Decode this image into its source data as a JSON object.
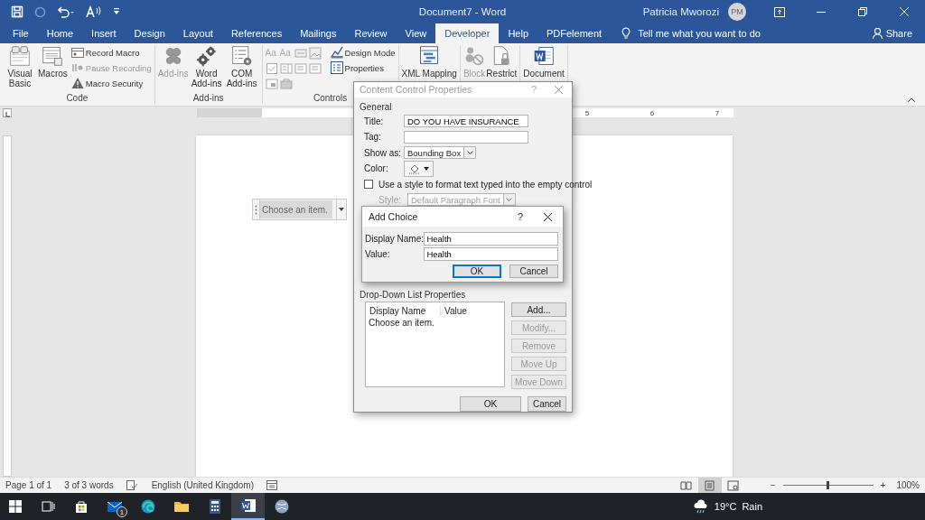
{
  "window": {
    "title": "Document7 - Word",
    "user": "Patricia Mworozi",
    "avatar": "PM"
  },
  "tabs": [
    {
      "label": "File",
      "selected": false
    },
    {
      "label": "Home",
      "selected": false
    },
    {
      "label": "Insert",
      "selected": false
    },
    {
      "label": "Design",
      "selected": false
    },
    {
      "label": "Layout",
      "selected": false
    },
    {
      "label": "References",
      "selected": false
    },
    {
      "label": "Mailings",
      "selected": false
    },
    {
      "label": "Review",
      "selected": false
    },
    {
      "label": "View",
      "selected": false
    },
    {
      "label": "Developer",
      "selected": true
    },
    {
      "label": "Help",
      "selected": false
    },
    {
      "label": "PDFelement",
      "selected": false
    }
  ],
  "tell_me": {
    "placeholder": "Tell me what you want to do"
  },
  "share": "Share",
  "ribbon": {
    "groups": [
      {
        "name": "Code",
        "items": [
          {
            "kind": "large",
            "label": "Visual Basic",
            "disabled": false
          },
          {
            "kind": "large",
            "label": "Macros",
            "disabled": false
          },
          {
            "kind": "stack",
            "buttons": [
              {
                "label": "Record Macro",
                "disabled": false
              },
              {
                "label": "Pause Recording",
                "disabled": true
              },
              {
                "label": "Macro Security",
                "disabled": false
              }
            ]
          }
        ]
      },
      {
        "name": "Add-ins",
        "items": [
          {
            "kind": "large",
            "label": "Add-ins",
            "disabled": true
          },
          {
            "kind": "large",
            "label": "Word Add-ins",
            "disabled": false
          },
          {
            "kind": "large",
            "label": "COM Add-ins",
            "disabled": false
          }
        ]
      },
      {
        "name": "Controls",
        "items": [
          {
            "kind": "grid",
            "glyphs": [
              "Aa",
              "Aa"
            ]
          },
          {
            "kind": "stack",
            "buttons": [
              {
                "label": "Design Mode",
                "disabled": false
              },
              {
                "label": "Properties",
                "disabled": false
              }
            ]
          }
        ]
      },
      {
        "items": [
          {
            "kind": "large",
            "label": "XML Mapping",
            "disabled": false
          }
        ]
      },
      {
        "items": [
          {
            "kind": "large",
            "label": "Block",
            "disabled": true
          },
          {
            "kind": "large",
            "label": "Restrict",
            "disabled": false
          }
        ]
      },
      {
        "items": [
          {
            "kind": "large",
            "label": "Document",
            "disabled": false
          }
        ]
      }
    ]
  },
  "ruler": {
    "labels": [
      "5",
      "6",
      "7"
    ]
  },
  "document": {
    "control": {
      "text": "Choose an item."
    }
  },
  "content_control_dialog": {
    "title": "Content Control Properties",
    "help": "?",
    "section_general": "General",
    "fields": [
      {
        "kind": "text",
        "label": "Title:",
        "value": "DO YOU HAVE INSURANCE"
      },
      {
        "kind": "text",
        "label": "Tag:"
      },
      {
        "kind": "dropdown",
        "label": "Show as:",
        "value": "Bounding Box"
      },
      {
        "kind": "color",
        "label": "Color:"
      }
    ],
    "use_style": {
      "label": "Use a style to format text typed into the empty control",
      "checked": false
    },
    "style": {
      "label": "Style:",
      "value": "Default Paragraph Font",
      "disabled": true
    },
    "list_section": "Drop-Down List Properties",
    "list": {
      "columns": [
        "Display Name",
        "Value"
      ],
      "rows": [
        {
          "display_name": "Choose an item."
        }
      ]
    },
    "list_buttons": [
      {
        "label": "Add...",
        "disabled": false
      },
      {
        "label": "Modify...",
        "disabled": true
      },
      {
        "label": "Remove",
        "disabled": true
      },
      {
        "label": "Move Up",
        "disabled": true
      },
      {
        "label": "Move Down",
        "disabled": true
      }
    ],
    "buttons": [
      "OK",
      "Cancel"
    ]
  },
  "add_choice_dialog": {
    "title": "Add Choice",
    "help": "?",
    "fields": [
      {
        "label": "Display Name:",
        "value": "Health"
      },
      {
        "label": "Value:",
        "value": "Health"
      }
    ],
    "buttons": [
      {
        "label": "OK",
        "default": true
      },
      {
        "label": "Cancel",
        "default": false
      }
    ]
  },
  "status_bar": {
    "page": "Page 1 of 1",
    "words": "3 of 3 words",
    "language": "English (United Kingdom)",
    "views": [
      {
        "selected": false
      },
      {
        "selected": true
      },
      {
        "selected": false
      }
    ],
    "zoom_out": "−",
    "zoom_in": "+",
    "zoom": {
      "level": 0.5
    },
    "zoom_reading": "100%"
  },
  "taskbar": {
    "apps": [
      {
        "active": false
      },
      {
        "active": false
      },
      {
        "active": false
      },
      {
        "active": false,
        "badge": "1"
      },
      {
        "active": false
      },
      {
        "active": false
      },
      {
        "active": false
      },
      {
        "active": true
      },
      {
        "active": false
      }
    ],
    "weather": {
      "temperature": "19°C",
      "condition": "Rain"
    }
  }
}
